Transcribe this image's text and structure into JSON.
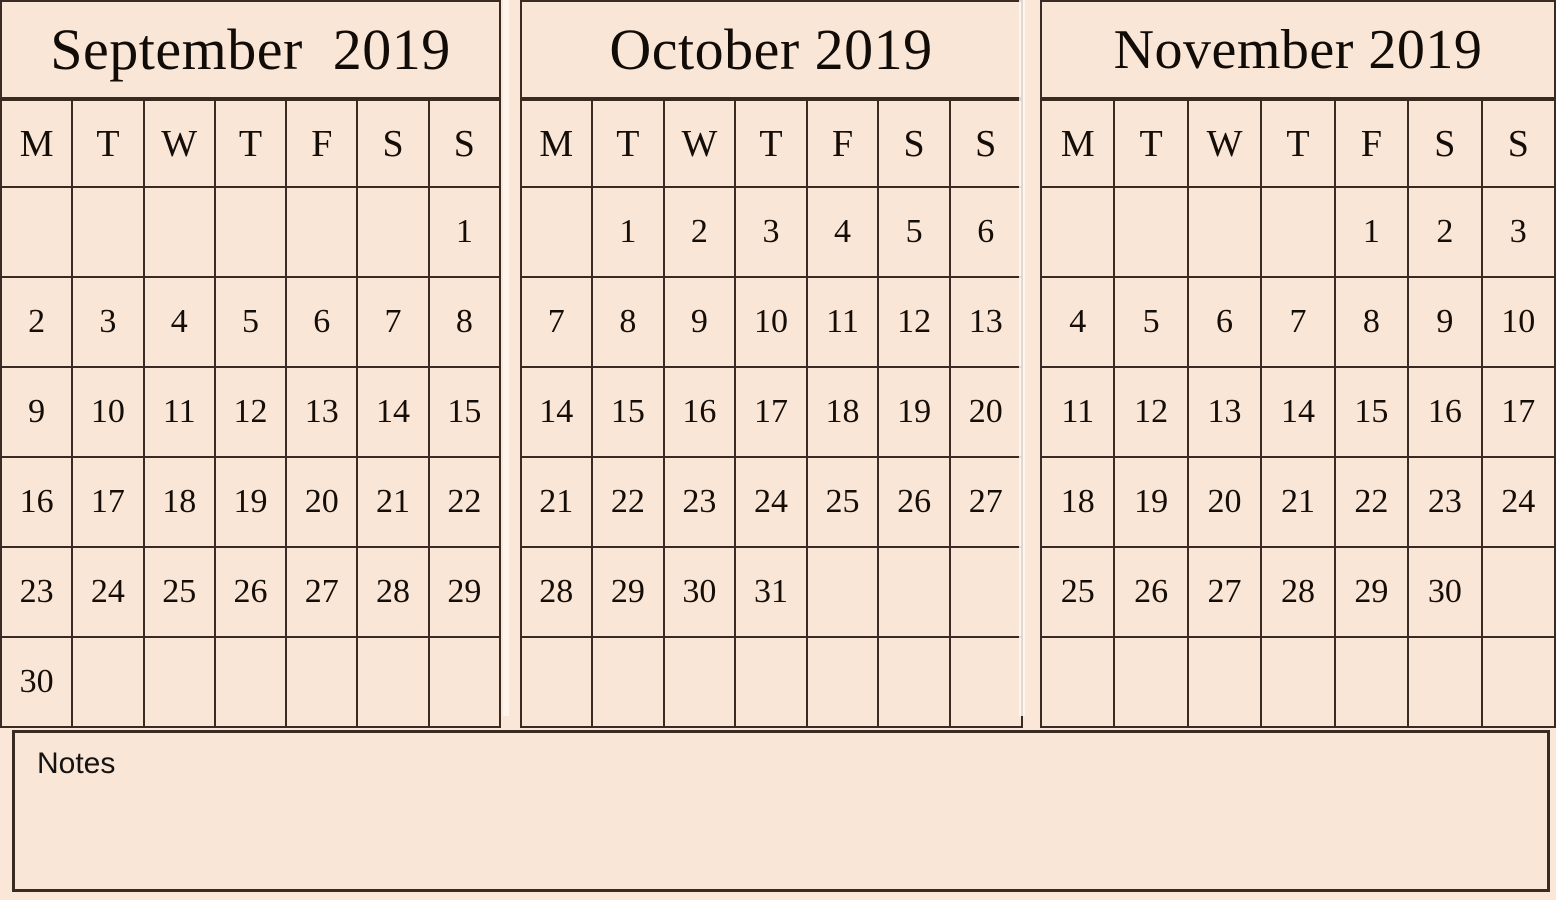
{
  "page": {
    "background_color": "#FBE7D8",
    "cell_fill_color": "#FAE6D6",
    "border_color": "#3A2B22",
    "text_color": "#140D08"
  },
  "weekday_headers": [
    "M",
    "T",
    "W",
    "T",
    "F",
    "S",
    "S"
  ],
  "months": [
    {
      "name": "September",
      "year": "2019",
      "title": "September  2019",
      "first_weekday_index": 6,
      "days_in_month": 30,
      "weeks": [
        [
          "",
          "",
          "",
          "",
          "",
          "",
          "1"
        ],
        [
          "2",
          "3",
          "4",
          "5",
          "6",
          "7",
          "8"
        ],
        [
          "9",
          "10",
          "11",
          "12",
          "13",
          "14",
          "15"
        ],
        [
          "16",
          "17",
          "18",
          "19",
          "20",
          "21",
          "22"
        ],
        [
          "23",
          "24",
          "25",
          "26",
          "27",
          "28",
          "29"
        ],
        [
          "30",
          "",
          "",
          "",
          "",
          "",
          ""
        ]
      ]
    },
    {
      "name": "October",
      "year": "2019",
      "title": "October 2019",
      "first_weekday_index": 1,
      "days_in_month": 31,
      "weeks": [
        [
          "",
          "1",
          "2",
          "3",
          "4",
          "5",
          "6"
        ],
        [
          "7",
          "8",
          "9",
          "10",
          "11",
          "12",
          "13"
        ],
        [
          "14",
          "15",
          "16",
          "17",
          "18",
          "19",
          "20"
        ],
        [
          "21",
          "22",
          "23",
          "24",
          "25",
          "26",
          "27"
        ],
        [
          "28",
          "29",
          "30",
          "31",
          "",
          "",
          ""
        ],
        [
          "",
          "",
          "",
          "",
          "",
          "",
          ""
        ]
      ]
    },
    {
      "name": "November",
      "year": "2019",
      "title": "November 2019",
      "first_weekday_index": 4,
      "days_in_month": 30,
      "weeks": [
        [
          "",
          "",
          "",
          "",
          "1",
          "2",
          "3"
        ],
        [
          "4",
          "5",
          "6",
          "7",
          "8",
          "9",
          "10"
        ],
        [
          "11",
          "12",
          "13",
          "14",
          "15",
          "16",
          "17"
        ],
        [
          "18",
          "19",
          "20",
          "21",
          "22",
          "23",
          "24"
        ],
        [
          "25",
          "26",
          "27",
          "28",
          "29",
          "30",
          ""
        ],
        [
          "",
          "",
          "",
          "",
          "",
          "",
          ""
        ]
      ]
    }
  ],
  "notes": {
    "label": "Notes",
    "content": ""
  }
}
